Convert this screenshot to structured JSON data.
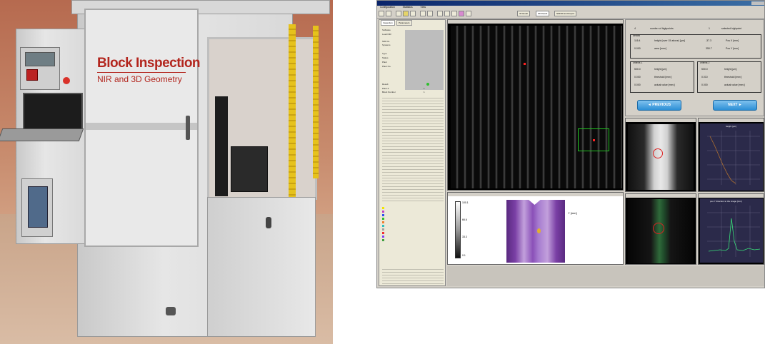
{
  "photo": {
    "brand_title": "Block Inspection",
    "brand_subtitle": "NIR and 3D Geometry"
  },
  "app": {
    "menu": [
      "Configuration",
      "Statistics",
      "View"
    ],
    "toolbar_tabs": [
      "IF Result",
      "3D Result",
      "NIR/3D and Export"
    ],
    "side_tabs": [
      "Inspection",
      "Parameters"
    ],
    "side_labels": [
      "Software",
      "Load NIR",
      "NIR-Vis",
      "Systems",
      "Type",
      "Status",
      "Plant",
      "Plant No."
    ],
    "result_labels": [
      "Result",
      "Plant #",
      "Block Number"
    ],
    "result_values": [
      "",
      "1",
      "1"
    ],
    "info": {
      "count": "4",
      "count_label": "number of highpoints",
      "selected": "1",
      "selected_label": "selected highpoint",
      "details_title": "details",
      "height_val": "116.4",
      "height_label": "height (over 15 above) [µm]",
      "pos_x_val": "-37.3",
      "pos_x_label": "Pos X [mm]",
      "area_val": "0.000",
      "area_label": "area [mm²]",
      "pos_y_val": "350.7",
      "pos_y_label": "Pos Y [mm]",
      "c1_title": "criteria 1",
      "c1_height_val": "500.0",
      "c1_height_label": "height [µm]",
      "c1_thr_val": "0.000",
      "c1_thr_label": "threshold [mm²]",
      "c1_act_val": "0.000",
      "c1_act_label": "actual value [mm²]",
      "c2_title": "criteria 2",
      "c2_height_val": "500.0",
      "c2_height_label": "height [µm]",
      "c2_thr_val": "0.010",
      "c2_thr_label": "threshold [mm²]",
      "c2_act_val": "0.000",
      "c2_act_label": "actual value [mm²]",
      "prev_button": "◄ PREVIOUS",
      "next_button": "NEXT ►"
    },
    "graph1_title": "height [µm]",
    "graph2_title": "pos Y direction to the image [mm]",
    "colorbar_labels": [
      "100.1",
      "66.6",
      "33.3",
      "0.1"
    ],
    "colorbar_axis": "Y [mm]",
    "colors": {
      "title_bar": "#0a246a",
      "nav_button": "#2d8fd6",
      "highlight_box": "#22c322",
      "defect_dot": "#ff2222",
      "graph_bg": "#2b2a4a",
      "graph_line": "#39e07a"
    }
  }
}
